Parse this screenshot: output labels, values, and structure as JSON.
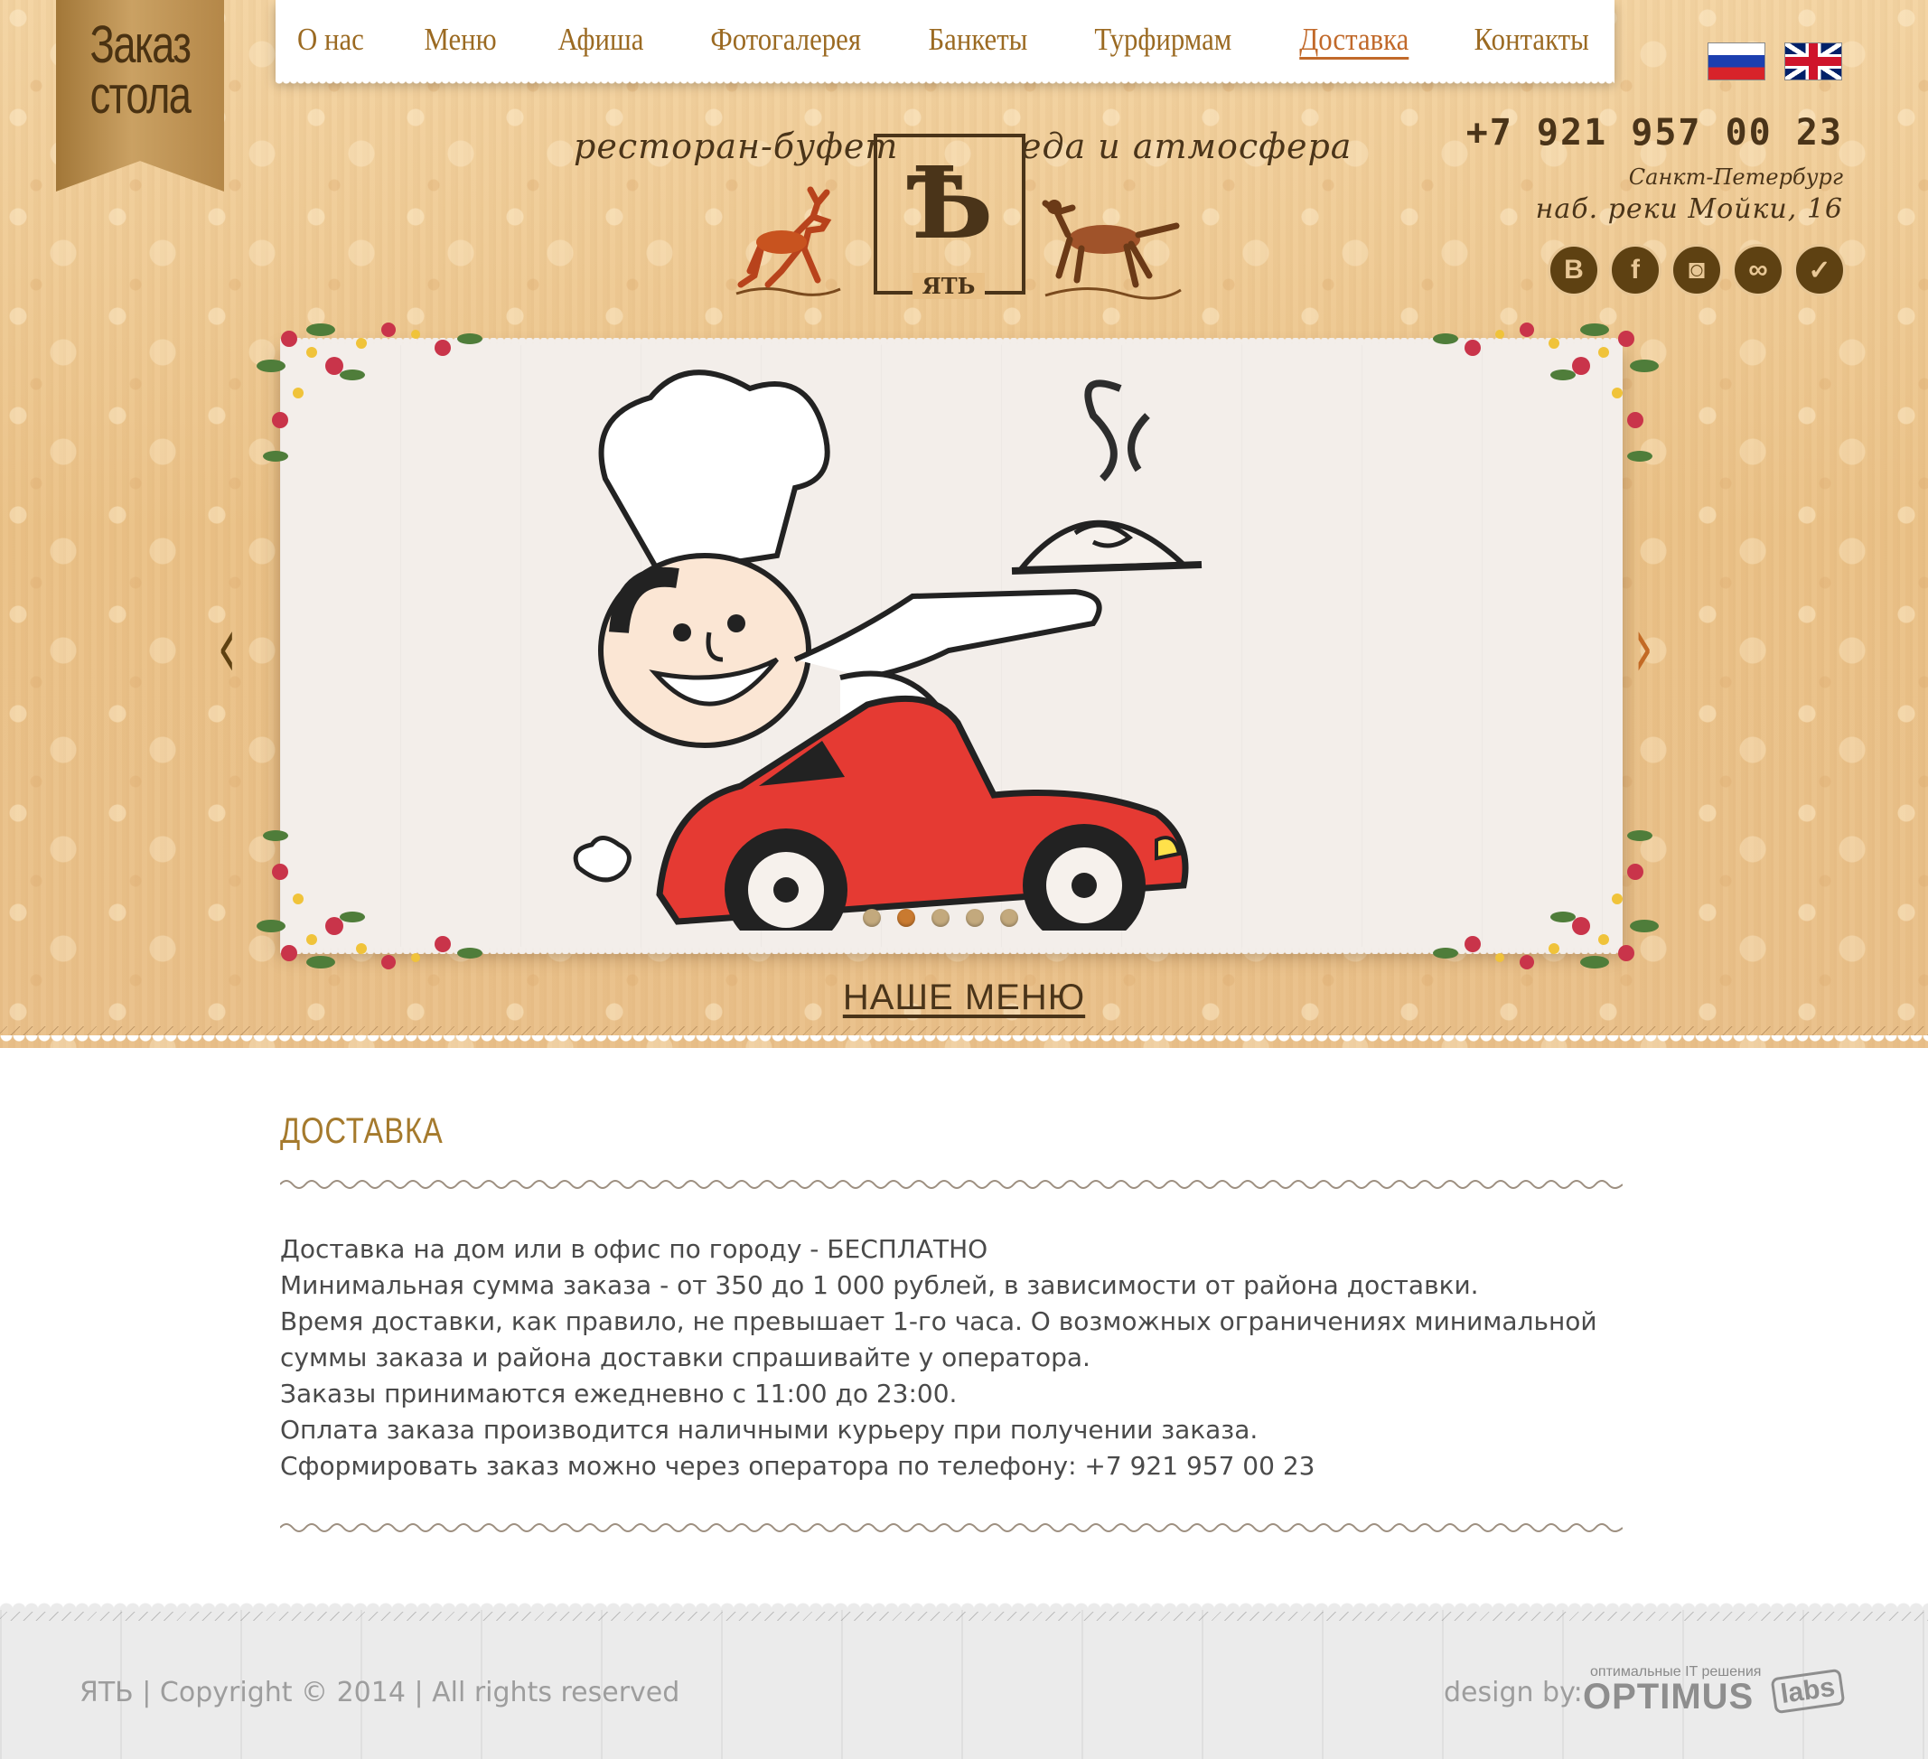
{
  "ribbon": {
    "line1": "Заказ",
    "line2": "стола"
  },
  "nav": {
    "items": [
      {
        "label": "О нас"
      },
      {
        "label": "Меню"
      },
      {
        "label": "Афиша"
      },
      {
        "label": "Фотогалерея"
      },
      {
        "label": "Банкеты"
      },
      {
        "label": "Турфирмам"
      },
      {
        "label": "Доставка",
        "active": true
      },
      {
        "label": "Контакты"
      }
    ]
  },
  "languages": [
    {
      "icon": "russia-flag-icon"
    },
    {
      "icon": "uk-flag-icon"
    }
  ],
  "logo": {
    "tagline_left": "ресторан-буфет",
    "tagline_right": "еда и атмосфера",
    "letter": "Ѣ",
    "name": "ЯТЬ"
  },
  "contacts": {
    "phone": "+7 921 957 00 23",
    "city": "Санкт-Петербург",
    "address": "наб. реки Мойки, 16"
  },
  "socials": [
    {
      "icon": "vk-icon",
      "glyph": "B"
    },
    {
      "icon": "facebook-icon",
      "glyph": "f"
    },
    {
      "icon": "instagram-icon",
      "glyph": "◙"
    },
    {
      "icon": "tripadvisor-icon",
      "glyph": "∞"
    },
    {
      "icon": "foursquare-icon",
      "glyph": "✓"
    }
  ],
  "slider": {
    "prev": "‹",
    "next": "›",
    "dots": 5,
    "active_dot": 1
  },
  "menu_link": "НАШЕ МЕНЮ",
  "content": {
    "title": "ДОСТАВКА",
    "lines": [
      "Доставка на дом или в офис по городу - БЕСПЛАТНО",
      "Минимальная сумма заказа - от 350 до 1 000 рублей, в зависимости от района доставки.",
      "Время доставки, как правило, не превышает 1-го часа.  О возможных ограничениях  минимальной",
      "суммы заказа и района доставки  спрашивайте у оператора.",
      "Заказы принимаются ежедневно с 11:00 до 23:00.",
      "Оплата заказа производится наличными курьеру при получении заказа.",
      "Сформировать заказ можно через оператора по телефону: +7 921 957 00 23"
    ]
  },
  "footer": {
    "copyright": "ЯТЬ  |  Copyright  ©  2014  |  All rights reserved",
    "design_by": "design by:",
    "optimus_sub": "оптимальные IT решения",
    "optimus": "OPTIMUS",
    "labs": "labs"
  },
  "colors": {
    "brown": "#4a3419",
    "gold": "#9b6a22",
    "accent": "#c1692a",
    "car_red": "#e53a33"
  }
}
